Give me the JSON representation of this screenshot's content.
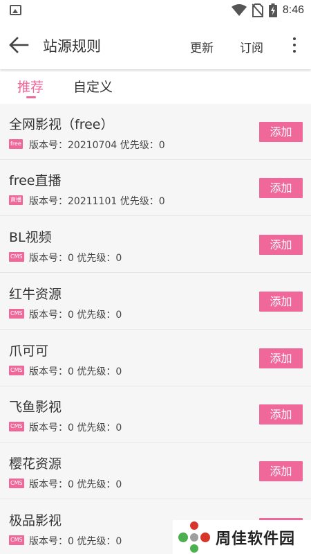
{
  "status": {
    "time": "8:46"
  },
  "header": {
    "title": "站源规则",
    "update_label": "更新",
    "subscribe_label": "订阅"
  },
  "tabs": [
    {
      "label": "推荐"
    },
    {
      "label": "自定义"
    }
  ],
  "accent_color": "#f0679a",
  "meta_labels": {
    "version": "版本号：",
    "priority": "优先级："
  },
  "items": [
    {
      "name": "全网影视（free）",
      "tag": "free",
      "version": "20210704",
      "priority": "0",
      "action": "添加"
    },
    {
      "name": "free直播",
      "tag": "直播",
      "version": "20211101",
      "priority": "0",
      "action": "添加"
    },
    {
      "name": "BL视频",
      "tag": "CMS",
      "version": "0",
      "priority": "0",
      "action": "添加"
    },
    {
      "name": "红牛资源",
      "tag": "CMS",
      "version": "0",
      "priority": "0",
      "action": "添加"
    },
    {
      "name": "爪可可",
      "tag": "CMS",
      "version": "0",
      "priority": "0",
      "action": "添加"
    },
    {
      "name": "飞鱼影视",
      "tag": "CMS",
      "version": "0",
      "priority": "0",
      "action": "添加"
    },
    {
      "name": "樱花资源",
      "tag": "CMS",
      "version": "0",
      "priority": "0",
      "action": "添加"
    },
    {
      "name": "极品影视",
      "tag": "CMS",
      "version": "0",
      "priority": "0",
      "action": "添加"
    }
  ],
  "watermark": {
    "text": "周佳软件园"
  }
}
